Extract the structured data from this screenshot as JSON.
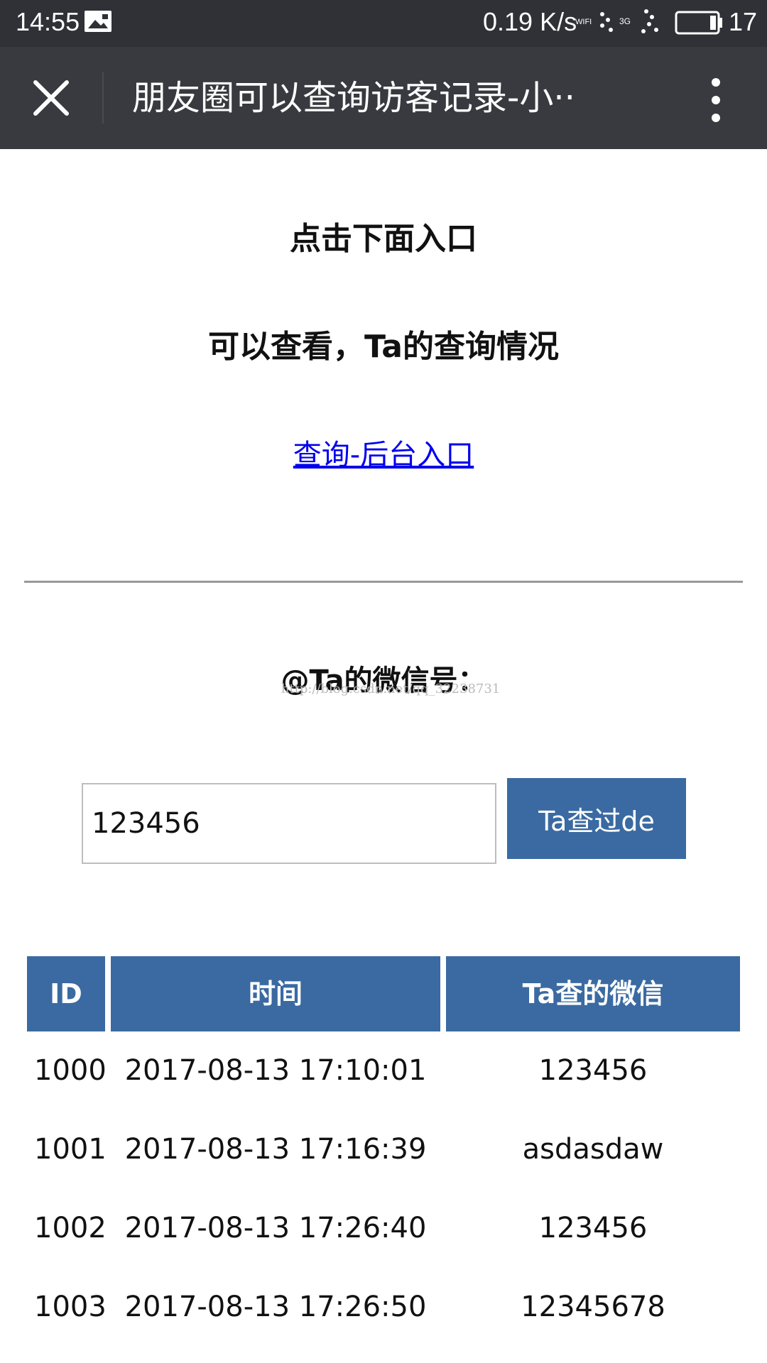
{
  "status_bar": {
    "time": "14:55",
    "speed": "0.19 K/s",
    "wifi_label": "WIFI",
    "network_label": "3G",
    "battery": "17",
    "icons": [
      "photo-icon",
      "wifi-icon",
      "signal-3g-icon",
      "battery-icon"
    ]
  },
  "title_bar": {
    "title": "朋友圈可以查询访客记录-小··",
    "icons": [
      "close-icon",
      "more-vertical-icon"
    ]
  },
  "content": {
    "heading1": "点击下面入口",
    "heading2": "可以查看，Ta的查询情况",
    "entry_link": "查询-后台入口",
    "wx_label": "@Ta的微信号：",
    "watermark": "http://blog.csdn.net/qq_32238731",
    "input_value": "123456",
    "query_button": "Ta查过de"
  },
  "table": {
    "headers": [
      "ID",
      "时间",
      "Ta查的微信"
    ],
    "rows": [
      {
        "id": "1000",
        "time": "2017-08-13 17:10:01",
        "wx": "123456"
      },
      {
        "id": "1001",
        "time": "2017-08-13 17:16:39",
        "wx": "asdasdaw"
      },
      {
        "id": "1002",
        "time": "2017-08-13 17:26:40",
        "wx": "123456"
      },
      {
        "id": "1003",
        "time": "2017-08-13 17:26:50",
        "wx": "12345678"
      }
    ]
  },
  "colors": {
    "status_bar_bg": "#2f3136",
    "title_bar_bg": "#393a3f",
    "accent_blue": "#3a6aa1",
    "link_blue": "#0000ee"
  }
}
